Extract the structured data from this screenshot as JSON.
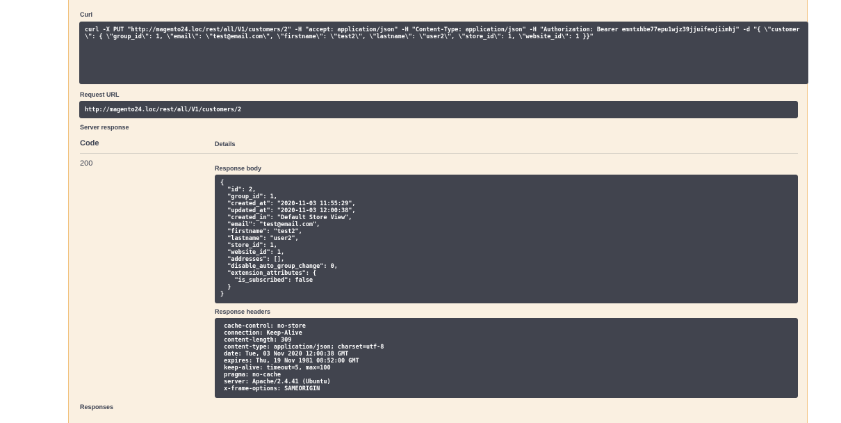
{
  "sections": {
    "curl_label": "Curl",
    "request_url_label": "Request URL",
    "server_response_label": "Server response",
    "responses_label": "Responses"
  },
  "curl": {
    "command": "curl -X PUT \"http://magento24.loc/rest/all/V1/customers/2\" -H \"accept: application/json\" -H \"Content-Type: application/json\" -H \"Authorization: Bearer emntxhbe77epu1wjz39jjuifeojiimhj\" -d \"{ \\\"customer\\\": { \\\"group_id\\\": 1, \\\"email\\\": \\\"test@email.com\\\", \\\"firstname\\\": \\\"test2\\\", \\\"lastname\\\": \\\"user2\\\", \\\"store_id\\\": 1, \\\"website_id\\\": 1 }}\""
  },
  "request_url": "http://magento24.loc/rest/all/V1/customers/2",
  "response_table": {
    "code_header": "Code",
    "details_header": "Details",
    "status_code": "200",
    "response_body_label": "Response body",
    "response_body": "{\n  \"id\": 2,\n  \"group_id\": 1,\n  \"created_at\": \"2020-11-03 11:55:29\",\n  \"updated_at\": \"2020-11-03 12:00:38\",\n  \"created_in\": \"Default Store View\",\n  \"email\": \"test@email.com\",\n  \"firstname\": \"test2\",\n  \"lastname\": \"user2\",\n  \"store_id\": 1,\n  \"website_id\": 1,\n  \"addresses\": [],\n  \"disable_auto_group_change\": 0,\n  \"extension_attributes\": {\n    \"is_subscribed\": false\n  }\n}",
    "response_headers_label": "Response headers",
    "response_headers": " cache-control: no-store \n connection: Keep-Alive \n content-length: 309 \n content-type: application/json; charset=utf-8 \n date: Tue, 03 Nov 2020 12:00:38 GMT \n expires: Thu, 19 Nov 1981 08:52:00 GMT \n keep-alive: timeout=5, max=100 \n pragma: no-cache \n server: Apache/2.4.41 (Ubuntu) \n x-frame-options: SAMEORIGIN "
  }
}
